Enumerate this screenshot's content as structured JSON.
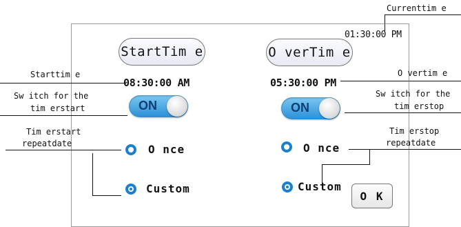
{
  "panel": {
    "start_time_button": "StartTim e",
    "over_time_button": "O verTim e",
    "current_time": "01:30:00 PM",
    "start_time_value": "08:30:00 AM",
    "over_time_value": "05:30:00 PM",
    "start_toggle_label": "ON",
    "stop_toggle_label": "ON",
    "start_once_label": "O nce",
    "start_custom_label": "Custom",
    "stop_once_label": "O nce",
    "stop_custom_label": "Custom",
    "ok_label": "O K"
  },
  "annotations": {
    "current_time": "Currenttim e",
    "start_time": "Starttim e",
    "over_time": "O vertim e",
    "switch_timer_start_1": "Sw itch for the",
    "switch_timer_start_2": "tim erstart",
    "switch_timer_stop_1": "Sw itch for the",
    "switch_timer_stop_2": "tim erstop",
    "timer_start_repeat_1": "Tim erstart",
    "timer_start_repeat_2": "repeatdate",
    "timer_stop_repeat_1": "Tim erstop",
    "timer_stop_repeat_2": "repeatdate"
  },
  "state": {
    "start_toggle_on": true,
    "stop_toggle_on": true,
    "start_repeat_selected": "Custom",
    "stop_repeat_selected": "Custom"
  },
  "colors": {
    "accent": "#1a7fd1",
    "toggle_on": "#2a8fd6"
  }
}
